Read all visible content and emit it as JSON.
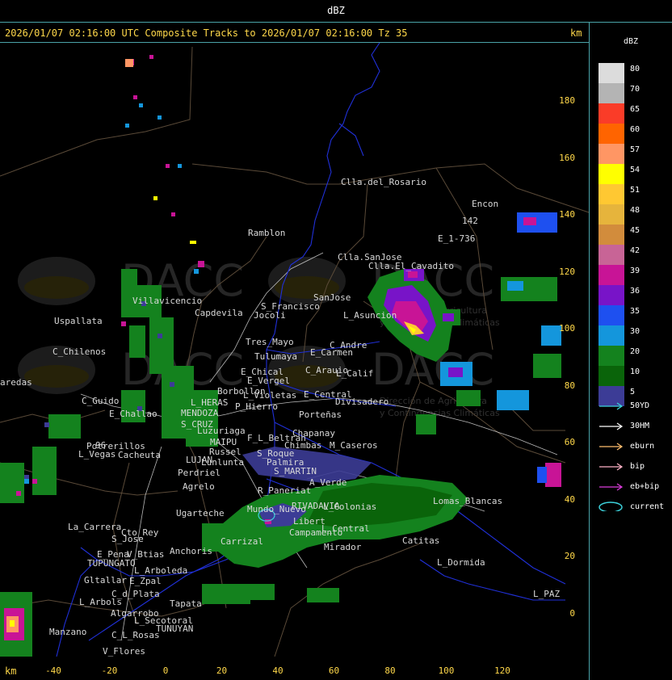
{
  "window_title": "dBZ",
  "tracks_title": "2026/01/07 02:16:00 UTC Composite Tracks to 2026/01/07 02:16:00 Tz 35",
  "km_label": "km",
  "legend": {
    "title": "dBZ",
    "scale": [
      {
        "label": "80",
        "color": "#dcdcdc"
      },
      {
        "label": "70",
        "color": "#b4b4b4"
      },
      {
        "label": "65",
        "color": "#fa3c28"
      },
      {
        "label": "60",
        "color": "#ff6400"
      },
      {
        "label": "57",
        "color": "#ff9664"
      },
      {
        "label": "54",
        "color": "#ffff00"
      },
      {
        "label": "51",
        "color": "#ffc832"
      },
      {
        "label": "48",
        "color": "#e6b43c"
      },
      {
        "label": "45",
        "color": "#d28c3c"
      },
      {
        "label": "42",
        "color": "#c86496"
      },
      {
        "label": "39",
        "color": "#c81496"
      },
      {
        "label": "36",
        "color": "#7814c8"
      },
      {
        "label": "35",
        "color": "#1e50f0"
      },
      {
        "label": "30",
        "color": "#1496dc"
      },
      {
        "label": "20",
        "color": "#14821e"
      },
      {
        "label": "10",
        "color": "#0a640a"
      },
      {
        "label": "5",
        "color": "#3c3c96"
      }
    ],
    "tracks": [
      {
        "label": "50YD",
        "color": "#3cd2dc"
      },
      {
        "label": "30HM",
        "color": "#ffffff"
      },
      {
        "label": "eburn",
        "color": "#ffbe6e"
      },
      {
        "label": "bip",
        "color": "#ffb4c8"
      },
      {
        "label": "eb+bip",
        "color": "#dc3cdc"
      },
      {
        "label": "current",
        "color": "#3cd2dc"
      }
    ]
  },
  "axes": {
    "y_ticks": [
      "180",
      "160",
      "140",
      "120",
      "100",
      "80",
      "60",
      "40",
      "20",
      "0"
    ],
    "x_ticks": [
      "-40",
      "-20",
      "0",
      "20",
      "40",
      "60",
      "80",
      "100",
      "120"
    ]
  },
  "watermark": {
    "name": "DACC",
    "subtitle_1": "Dirección de Agricultura",
    "subtitle_2": "y Contingencias Climáticas"
  },
  "places": [
    "Clla.del_Rosario",
    "Encon",
    "Ramblon",
    "142",
    "E_1-736",
    "Clla.SanJose",
    "Clla.El_Cavadito",
    "Villavicencio",
    "Uspallata",
    "Capdevila",
    "S_Francisco",
    "Jocoli",
    "SanJose",
    "L_Asuncion",
    "Tres_Mayo",
    "Tulumaya",
    "E_Carmen",
    "C_Andre",
    "C_Chilenos",
    "aredas",
    "E_Chical",
    "E_Vergel",
    "C_Arauio",
    "L_Calif",
    "Borbollon",
    "L_Violetas",
    "E_Central",
    "Divisadero",
    "C_Guido",
    "L_HERAS",
    "P_Hierro",
    "Porteñas",
    "E_Challao",
    "MENDOZA",
    "S_CRUZ",
    "Luzuriaga",
    "Chapanay",
    "F_L_Beltran",
    "Chimbas",
    "M_Caseros",
    "MAIPU",
    "Russel",
    "Potrerillos",
    "L_Vegas",
    "Cacheuta",
    "LUJAN",
    "Lunlunta",
    "S_Roque",
    "Palmira",
    "Perdriel",
    "S_MARTIN",
    "A_Verde",
    "Agrelo",
    "R_Paneriat",
    "Ugarteche",
    "Mundo_Nuevo",
    "RIVADAVIA",
    "L_Colonias",
    "Lomas_Blancas",
    "La_Carrera",
    "Cto_Rey",
    "S_Jose",
    "Carrizal",
    "Libert",
    "Campamento",
    "L_Central",
    "Catitas",
    "Mirador",
    "E_Pena",
    "V_Btias",
    "Anchoris",
    "TUPUNGATO",
    "L_Arboleda",
    "L_Dormida",
    "Gltallar",
    "E_Zpal",
    "C_d_Plata",
    "L_PAZ",
    "L_Arbols",
    "Tapata",
    "Algarrobo",
    "L_Secotoral",
    "TUNUYAN",
    "Manzano",
    "C_L_Rosas",
    "V_Flores",
    "96"
  ]
}
